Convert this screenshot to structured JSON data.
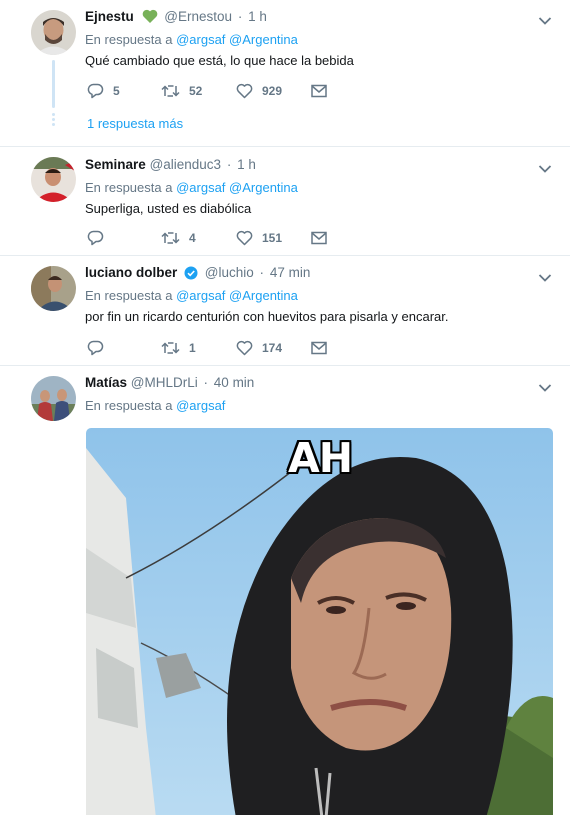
{
  "tweets": [
    {
      "name": "Ejnestu",
      "handle": "@Ernestou",
      "time": "1 h",
      "reply_prefix": "En respuesta a",
      "mentions": [
        "@argsaf",
        "@Argentina"
      ],
      "text": "Qué cambiado que está, lo que hace la bebida",
      "replies": "5",
      "retweets": "52",
      "likes": "929",
      "more_replies": "1 respuesta más",
      "badge": "green-heart-icon"
    },
    {
      "name": "Seminare",
      "handle": "@alienduc3",
      "time": "1 h",
      "reply_prefix": "En respuesta a",
      "mentions": [
        "@argsaf",
        "@Argentina"
      ],
      "text": "Superliga, usted es diabólica",
      "replies": "",
      "retweets": "4",
      "likes": "151"
    },
    {
      "name": "luciano dolber",
      "handle": "@luchio",
      "time": "47 min",
      "reply_prefix": "En respuesta a",
      "mentions": [
        "@argsaf",
        "@Argentina"
      ],
      "text": "por fin un ricardo centurión con huevitos para pisarla y encarar.",
      "replies": "",
      "retweets": "1",
      "likes": "174",
      "badge": "verified-badge-icon"
    },
    {
      "name": "Matías",
      "handle": "@MHLDrLi",
      "time": "40 min",
      "reply_prefix": "En respuesta a",
      "mentions": [
        "@argsaf"
      ],
      "media_caption": "AH"
    }
  ],
  "colors": {
    "link": "#1da1f2",
    "muted": "#657786",
    "text": "#14171a",
    "divider": "#e6ecf0",
    "thread": "#cfe4f5"
  }
}
